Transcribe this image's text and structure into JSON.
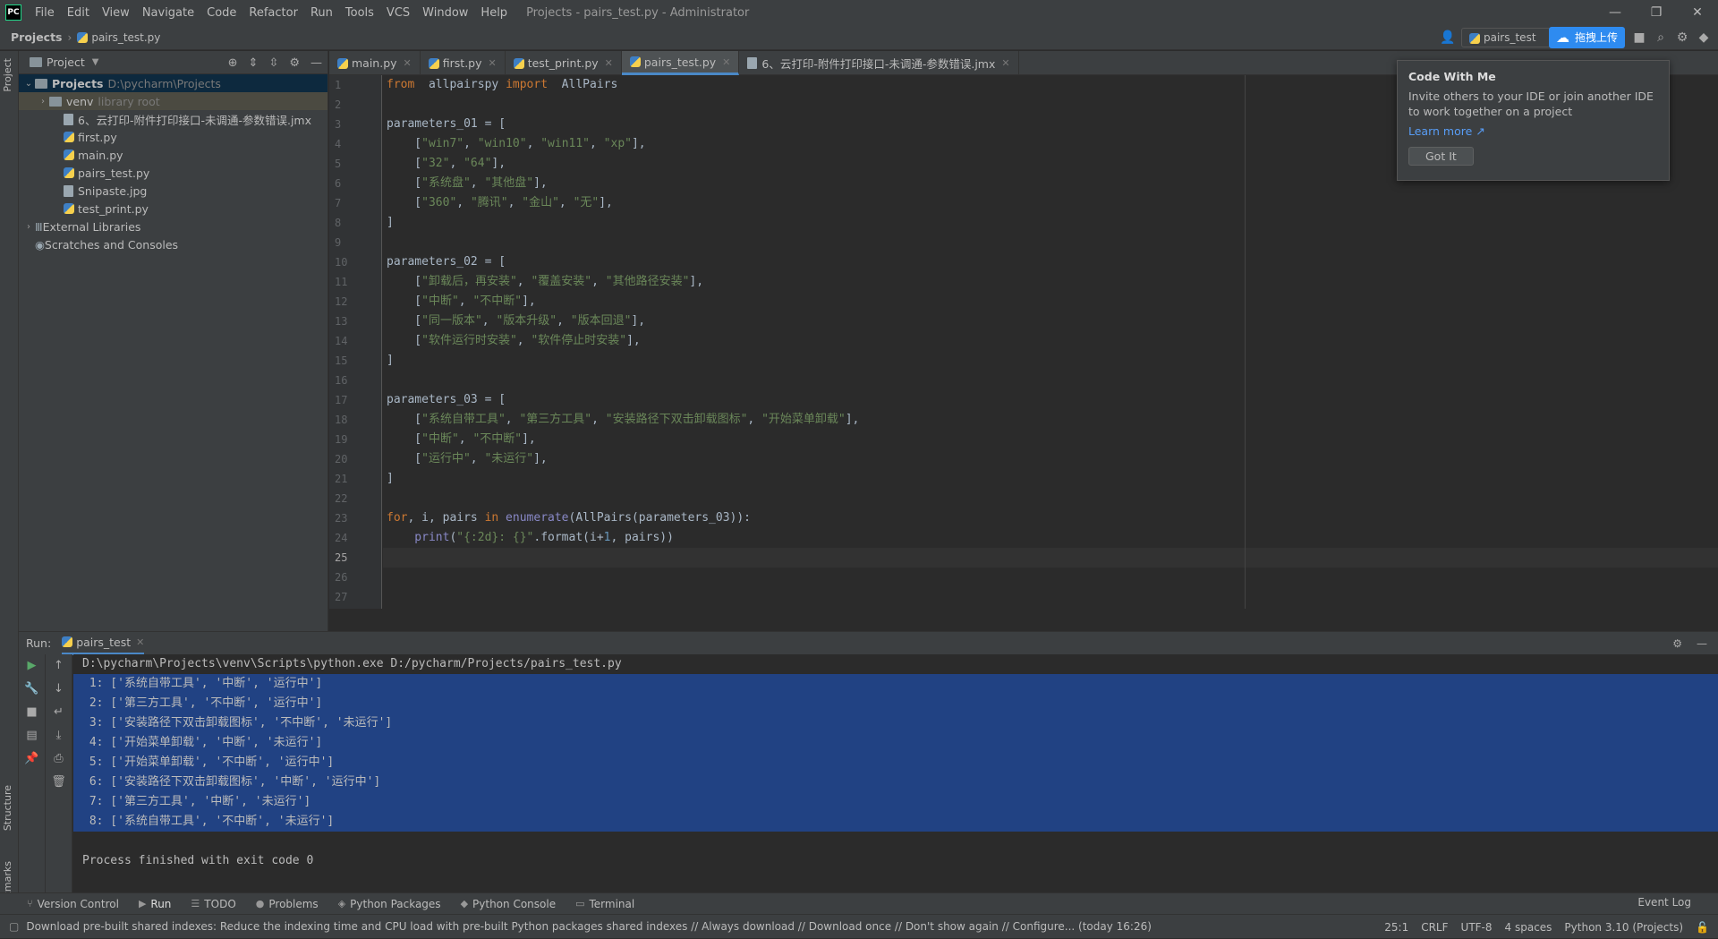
{
  "window": {
    "logo": "PC",
    "title": "Projects - pairs_test.py - Administrator",
    "menu": [
      "File",
      "Edit",
      "View",
      "Navigate",
      "Code",
      "Refactor",
      "Run",
      "Tools",
      "VCS",
      "Window",
      "Help"
    ],
    "controls": {
      "minimize": "—",
      "restore": "❐",
      "close": "✕"
    }
  },
  "navbar": {
    "root": "Projects",
    "file": "pairs_test.py",
    "run_config": "pairs_test",
    "upload_label": "拖拽上传"
  },
  "project_panel": {
    "title": "Project",
    "tree": [
      {
        "name": "Projects",
        "extra": "D:\\pycharm\\Projects",
        "type": "root"
      },
      {
        "name": "venv",
        "extra": "library root",
        "type": "folder"
      },
      {
        "name": "6、云打印-附件打印接口-未调通-参数错误.jmx",
        "type": "file"
      },
      {
        "name": "first.py",
        "type": "py"
      },
      {
        "name": "main.py",
        "type": "py"
      },
      {
        "name": "pairs_test.py",
        "type": "py"
      },
      {
        "name": "Snipaste.jpg",
        "type": "file"
      },
      {
        "name": "test_print.py",
        "type": "py"
      },
      {
        "name": "External Libraries",
        "type": "lib"
      },
      {
        "name": "Scratches and Consoles",
        "type": "scratch"
      }
    ]
  },
  "editor_tabs": [
    {
      "label": "main.py",
      "active": false
    },
    {
      "label": "first.py",
      "active": false
    },
    {
      "label": "test_print.py",
      "active": false
    },
    {
      "label": "pairs_test.py",
      "active": true
    },
    {
      "label": "6、云打印-附件打印接口-未调通-参数错误.jmx",
      "active": false
    }
  ],
  "line_numbers": [
    "1",
    "2",
    "3",
    "4",
    "5",
    "6",
    "7",
    "8",
    "9",
    "10",
    "11",
    "12",
    "13",
    "14",
    "15",
    "16",
    "17",
    "18",
    "19",
    "20",
    "21",
    "22",
    "23",
    "24",
    "25",
    "26",
    "27"
  ],
  "current_line": 25,
  "code_lines": [
    [
      [
        "kw",
        "from"
      ],
      [
        "",
        "  allpairspy "
      ],
      [
        "kw",
        "import"
      ],
      [
        "",
        "  AllPairs"
      ]
    ],
    [],
    [
      [
        "",
        "parameters_01 = ["
      ]
    ],
    [
      [
        "",
        "    ["
      ],
      [
        "str",
        "\"win7\""
      ],
      [
        "",
        ", "
      ],
      [
        "str",
        "\"win10\""
      ],
      [
        "",
        ", "
      ],
      [
        "str",
        "\"win11\""
      ],
      [
        "",
        ", "
      ],
      [
        "str",
        "\"xp\""
      ],
      [
        "",
        "],"
      ]
    ],
    [
      [
        "",
        "    ["
      ],
      [
        "str",
        "\"32\""
      ],
      [
        "",
        ", "
      ],
      [
        "str",
        "\"64\""
      ],
      [
        "",
        "],"
      ]
    ],
    [
      [
        "",
        "    ["
      ],
      [
        "str",
        "\"系统盘\""
      ],
      [
        "",
        ", "
      ],
      [
        "str",
        "\"其他盘\""
      ],
      [
        "",
        "],"
      ]
    ],
    [
      [
        "",
        "    ["
      ],
      [
        "str",
        "\"360\""
      ],
      [
        "",
        ", "
      ],
      [
        "str",
        "\"腾讯\""
      ],
      [
        "",
        ", "
      ],
      [
        "str",
        "\"金山\""
      ],
      [
        "",
        ", "
      ],
      [
        "str",
        "\"无\""
      ],
      [
        "",
        "],"
      ]
    ],
    [
      [
        "",
        "]"
      ]
    ],
    [],
    [
      [
        "",
        "parameters_02 = ["
      ]
    ],
    [
      [
        "",
        "    ["
      ],
      [
        "str",
        "\"卸载后，再安装\""
      ],
      [
        "",
        ", "
      ],
      [
        "str",
        "\"覆盖安装\""
      ],
      [
        "",
        ", "
      ],
      [
        "str",
        "\"其他路径安装\""
      ],
      [
        "",
        "],"
      ]
    ],
    [
      [
        "",
        "    ["
      ],
      [
        "str",
        "\"中断\""
      ],
      [
        "",
        ", "
      ],
      [
        "str",
        "\"不中断\""
      ],
      [
        "",
        "],"
      ]
    ],
    [
      [
        "",
        "    ["
      ],
      [
        "str",
        "\"同一版本\""
      ],
      [
        "",
        ", "
      ],
      [
        "str",
        "\"版本升级\""
      ],
      [
        "",
        ", "
      ],
      [
        "str",
        "\"版本回退\""
      ],
      [
        "",
        "],"
      ]
    ],
    [
      [
        "",
        "    ["
      ],
      [
        "str",
        "\"软件运行时安装\""
      ],
      [
        "",
        ", "
      ],
      [
        "str",
        "\"软件停止时安装\""
      ],
      [
        "",
        "],"
      ]
    ],
    [
      [
        "",
        "]"
      ]
    ],
    [],
    [
      [
        "",
        "parameters_03 = ["
      ]
    ],
    [
      [
        "",
        "    ["
      ],
      [
        "str",
        "\"系统自带工具\""
      ],
      [
        "",
        ", "
      ],
      [
        "str",
        "\"第三方工具\""
      ],
      [
        "",
        ", "
      ],
      [
        "str",
        "\"安装路径下双击卸载图标\""
      ],
      [
        "",
        ", "
      ],
      [
        "str",
        "\"开始菜单卸载\""
      ],
      [
        "",
        "],"
      ]
    ],
    [
      [
        "",
        "    ["
      ],
      [
        "str",
        "\"中断\""
      ],
      [
        "",
        ", "
      ],
      [
        "str",
        "\"不中断\""
      ],
      [
        "",
        "],"
      ]
    ],
    [
      [
        "",
        "    ["
      ],
      [
        "str",
        "\"运行中\""
      ],
      [
        "",
        ", "
      ],
      [
        "str",
        "\"未运行\""
      ],
      [
        "",
        "],"
      ]
    ],
    [
      [
        "",
        "]"
      ]
    ],
    [],
    [
      [
        "kw",
        "for"
      ],
      [
        "",
        ", i, pairs "
      ],
      [
        "kw",
        "in"
      ],
      [
        "",
        ""
      ],
      [
        "bi",
        " enumerate"
      ],
      [
        "",
        "(AllPairs(parameters_03)):"
      ]
    ],
    [
      [
        "bi",
        "    print"
      ],
      [
        "",
        "("
      ],
      [
        "str",
        "\"{:2d}: {}\""
      ],
      [
        "",
        ".format(i+"
      ],
      [
        "num",
        "1"
      ],
      [
        "",
        ", pairs))"
      ]
    ],
    [],
    [],
    []
  ],
  "popup": {
    "title": "Code With Me",
    "body": "Invite others to your IDE or join another IDE to work together on a project",
    "link": "Learn more ↗",
    "button": "Got It"
  },
  "run_panel": {
    "label": "Run:",
    "tab": "pairs_test",
    "command": "D:\\pycharm\\Projects\\venv\\Scripts\\python.exe D:/pycharm/Projects/pairs_test.py",
    "output": [
      " 1: ['系统自带工具', '中断', '运行中']",
      " 2: ['第三方工具', '不中断', '运行中']",
      " 3: ['安装路径下双击卸载图标', '不中断', '未运行']",
      " 4: ['开始菜单卸载', '中断', '未运行']",
      " 5: ['开始菜单卸载', '不中断', '运行中']",
      " 6: ['安装路径下双击卸载图标', '中断', '运行中']",
      " 7: ['第三方工具', '中断', '未运行']",
      " 8: ['系统自带工具', '不中断', '未运行']"
    ],
    "exit": "Process finished with exit code 0"
  },
  "bottom_tabs": [
    "Version Control",
    "Run",
    "TODO",
    "Problems",
    "Python Packages",
    "Python Console",
    "Terminal"
  ],
  "event_log": "Event Log",
  "left_strip": {
    "project": "Project",
    "structure": "Structure",
    "bookmarks": "Bookmarks"
  },
  "status": {
    "message": "Download pre-built shared indexes: Reduce the indexing time and CPU load with pre-built Python packages shared indexes // Always download // Download once // Don't show again // Configure... (today 16:26)",
    "position": "25:1",
    "line_sep": "CRLF",
    "encoding": "UTF-8",
    "indent": "4 spaces",
    "interpreter": "Python 3.10 (Projects)"
  }
}
